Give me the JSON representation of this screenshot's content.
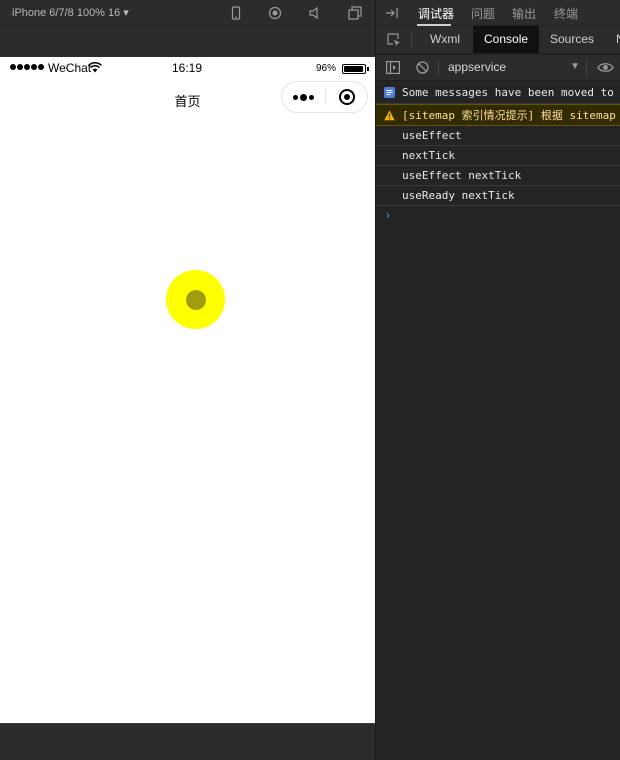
{
  "simulator": {
    "device_label": "iPhone 6/7/8 100% 16 ▾",
    "status": {
      "carrier": "WeChat",
      "time": "16:19",
      "battery": "96%",
      "battery_level": 0.96
    },
    "nav": {
      "title": "首页"
    },
    "loading_colors": {
      "outer": "#ffff00",
      "inner": "#a09c0c"
    }
  },
  "devtools": {
    "top_tabs": [
      "调试器",
      "问题",
      "输出",
      "终端"
    ],
    "panel_tabs": [
      "Wxml",
      "Console",
      "Sources",
      "N"
    ],
    "active_panel": "Console",
    "context": "appservice",
    "console": [
      {
        "level": "info",
        "text": "Some messages have been moved to t"
      },
      {
        "level": "warn",
        "text": "[sitemap 索引情况提示] 根据 sitemap"
      },
      {
        "level": "log",
        "text": "useEffect"
      },
      {
        "level": "log",
        "text": "nextTick"
      },
      {
        "level": "log",
        "text": "useEffect nextTick"
      },
      {
        "level": "log",
        "text": "useReady nextTick"
      }
    ],
    "prompt": "›"
  }
}
